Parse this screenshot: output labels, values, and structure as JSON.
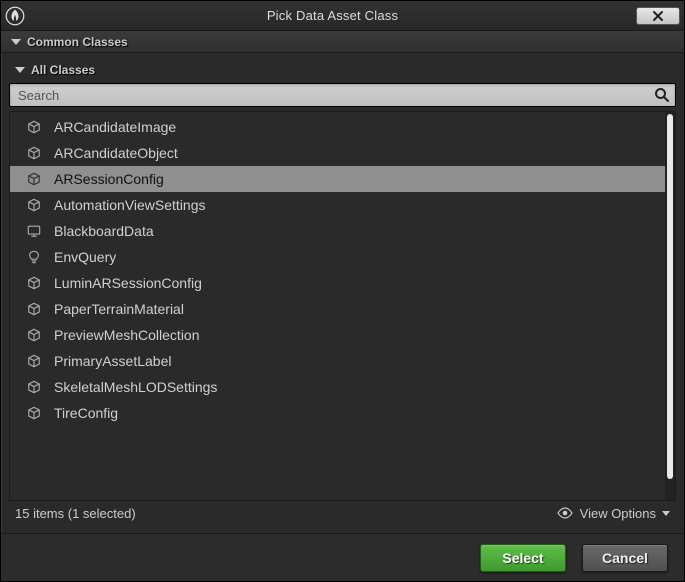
{
  "window": {
    "title": "Pick Data Asset Class"
  },
  "sections": {
    "common_label": "Common Classes",
    "all_label": "All Classes"
  },
  "search": {
    "placeholder": "Search",
    "value": ""
  },
  "classes": [
    {
      "name": "ARCandidateImage",
      "icon": "box",
      "selected": false
    },
    {
      "name": "ARCandidateObject",
      "icon": "box",
      "selected": false
    },
    {
      "name": "ARSessionConfig",
      "icon": "box",
      "selected": true
    },
    {
      "name": "AutomationViewSettings",
      "icon": "box",
      "selected": false
    },
    {
      "name": "BlackboardData",
      "icon": "monitor",
      "selected": false
    },
    {
      "name": "EnvQuery",
      "icon": "bulb",
      "selected": false
    },
    {
      "name": "LuminARSessionConfig",
      "icon": "box",
      "selected": false
    },
    {
      "name": "PaperTerrainMaterial",
      "icon": "box",
      "selected": false
    },
    {
      "name": "PreviewMeshCollection",
      "icon": "box",
      "selected": false
    },
    {
      "name": "PrimaryAssetLabel",
      "icon": "box",
      "selected": false
    },
    {
      "name": "SkeletalMeshLODSettings",
      "icon": "box",
      "selected": false
    },
    {
      "name": "TireConfig",
      "icon": "box",
      "selected": false
    }
  ],
  "status": {
    "text": "15 items (1 selected)",
    "view_options_label": "View Options"
  },
  "buttons": {
    "select_label": "Select",
    "cancel_label": "Cancel"
  }
}
